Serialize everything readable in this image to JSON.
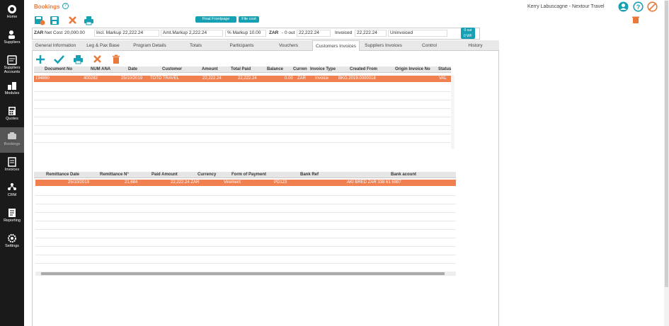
{
  "app": {
    "title": "Bookings",
    "user": "Kerry Labuscagne - Nextour Travel"
  },
  "sidebar": {
    "items": [
      {
        "label": "Home"
      },
      {
        "label": "Suppliers"
      },
      {
        "label": "Suppliers Accounts"
      },
      {
        "label": "Modules"
      },
      {
        "label": "Quotes"
      },
      {
        "label": "Bookings"
      },
      {
        "label": "Invoices"
      },
      {
        "label": "CRM"
      },
      {
        "label": "Reporting"
      },
      {
        "label": "Settings"
      }
    ]
  },
  "toolbar": {
    "final_frontpage": "Final Frontpage",
    "file_cost": "File cost"
  },
  "summary": {
    "currency1": "ZAR",
    "net_cost_label": "Net Cost",
    "net_cost_value": "20,000.00",
    "incl_markup_label": "Incl. Markup",
    "incl_markup_value": "22,222.24",
    "amt_markup_label": "Amt.Markup",
    "amt_markup_value": "2,222.24",
    "pct_markup_label": "% Markup",
    "pct_markup_value": "10.00",
    "currency2": "ZAR",
    "out_label": "- 0 out",
    "out_value": "22,222.24",
    "invoiced_label": "Invoiced",
    "invoiced_value": "22,222.24",
    "uninvoiced_label": "Uninvoiced",
    "out_badge_line1": "0 out",
    "out_badge_line2": "0 WF"
  },
  "tabs": [
    "General Information",
    "Leg & Pax Base",
    "Program Details",
    "Totals",
    "Participants",
    "Vouchers",
    "Customers Invoices",
    "Suppliers Invoices",
    "Control",
    "History"
  ],
  "invoices_table": {
    "headers": [
      "Document No",
      "NUM ANA",
      "Date",
      "Customer",
      "Amount",
      "Total Paid",
      "Balance",
      "Curren",
      "Invoice Type",
      "Created From",
      "Origin Invoice No",
      "Status"
    ],
    "rows": [
      [
        "194860",
        "400282",
        "25/10/2019",
        "TOTO TRAVEL",
        "22,222.24",
        "22,222.24",
        "0.00",
        "ZAR",
        "Invoice",
        "BKG.2019.0000018",
        "",
        "VAL"
      ]
    ]
  },
  "remittance_table": {
    "headers": [
      "Remittance Date",
      "Remittance N°",
      "Paid Amount",
      "Currency",
      "Form of Payment",
      "Bank Ref",
      "Bank acount"
    ],
    "rows": [
      [
        "25/10/2019",
        "21,684",
        "22,222.24 ZAR",
        "",
        "Virement",
        "PD123",
        "AKI BRED ZAR 338 61 5997"
      ]
    ]
  },
  "colors": {
    "accent": "#16a0b4",
    "selected_row": "#f08050",
    "title": "#e8793a",
    "danger": "#e8793a"
  }
}
